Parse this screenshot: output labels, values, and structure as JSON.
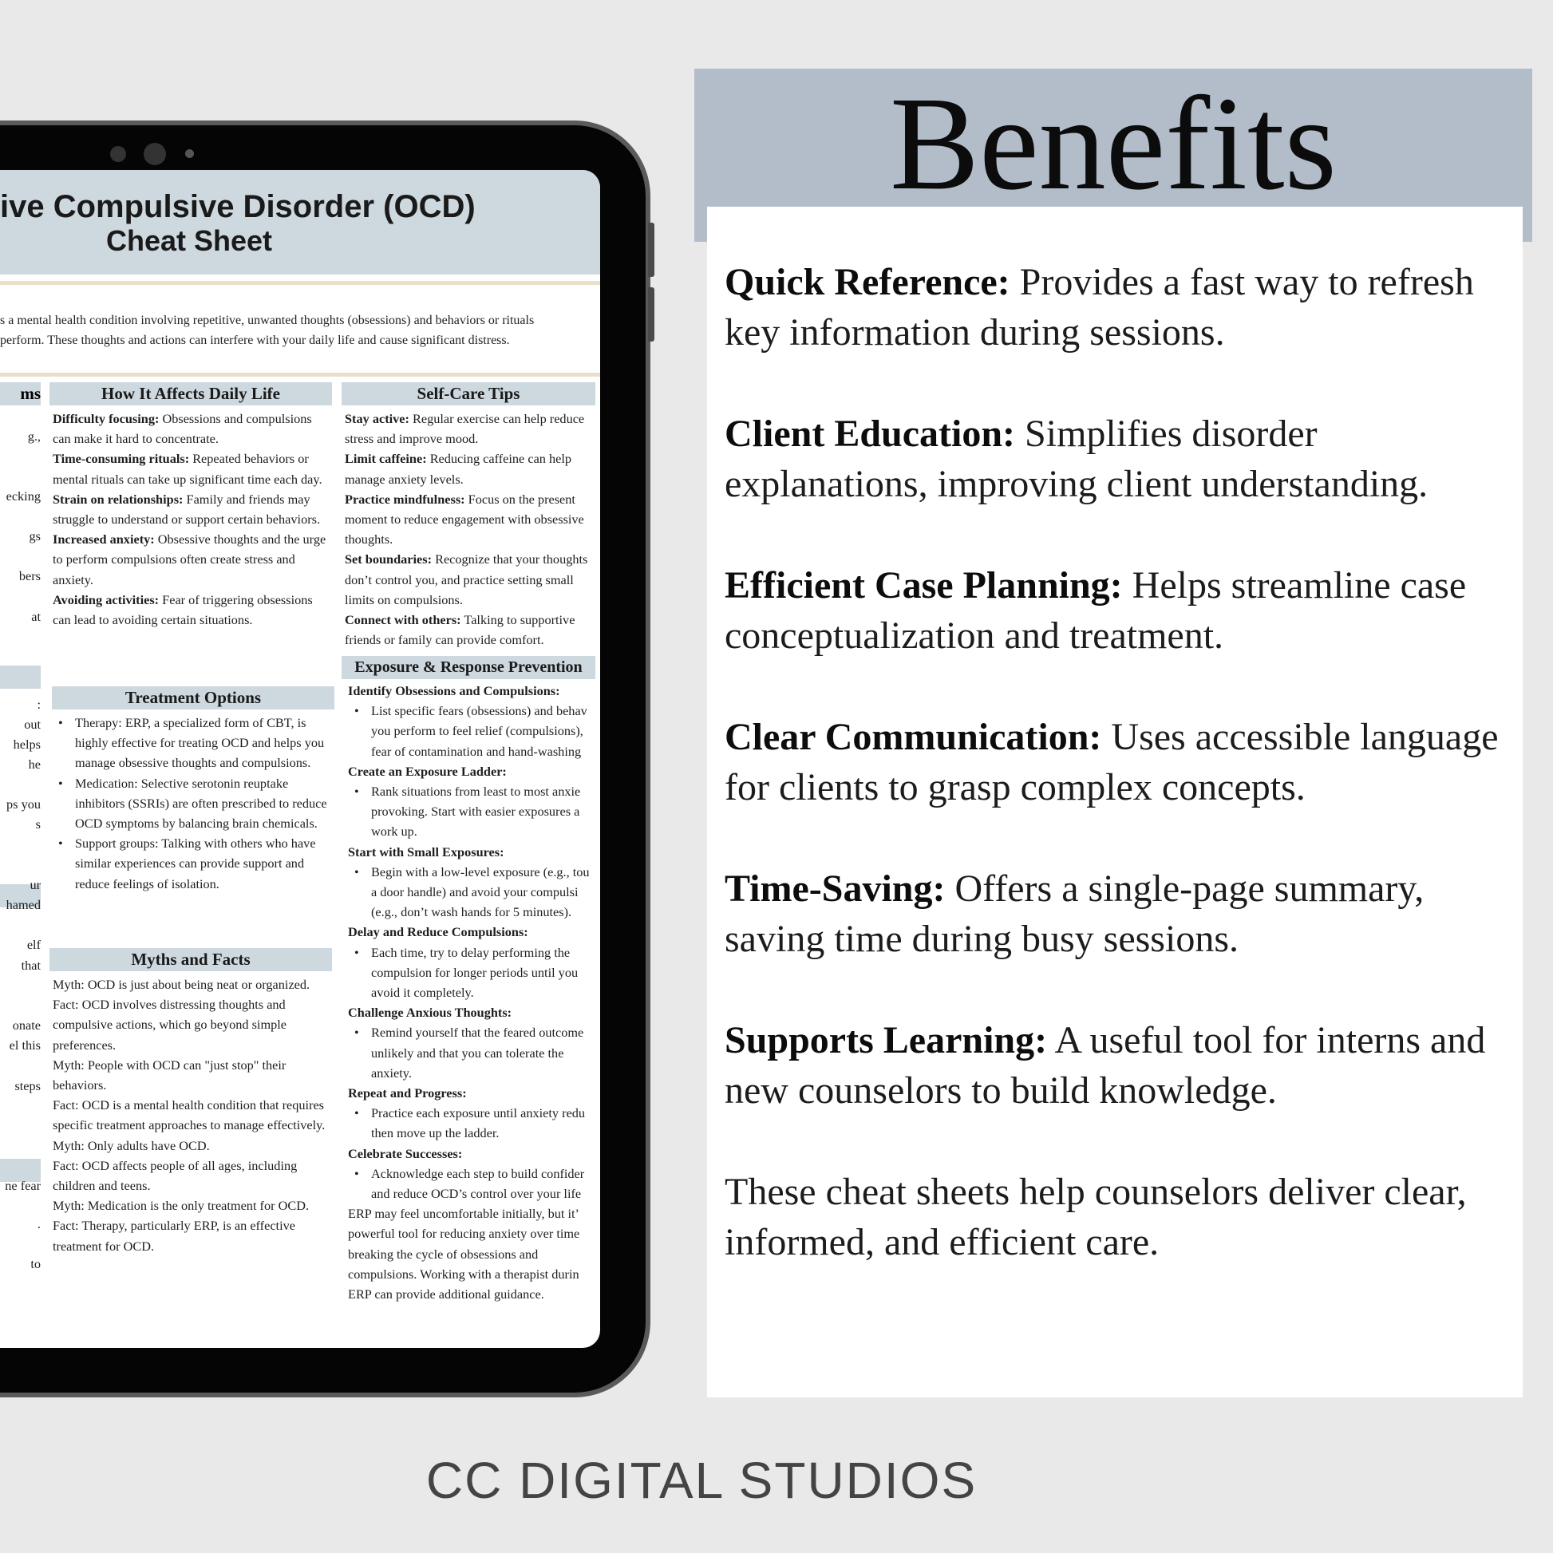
{
  "tablet": {
    "title_line1": "ive Compulsive Disorder (OCD)",
    "title_line2": "Cheat Sheet",
    "intro": [
      "s a mental health condition involving repetitive, unwanted thoughts (obsessions) and behaviors or rituals",
      " perform. These thoughts and actions can interfere with your daily life and cause significant distress."
    ],
    "col1_headers": [
      "ms",
      "",
      "",
      ""
    ],
    "col1_fragments": [
      "g.,",
      "ecking",
      "gs",
      "bers",
      "at",
      ":",
      "out",
      "helps",
      "he",
      "ps you",
      "s",
      "ur",
      "hamed",
      "elf",
      "that",
      "onate",
      "el this",
      "steps",
      "ne fear",
      ".",
      "to"
    ],
    "daily_life": {
      "heading": "How It Affects Daily Life",
      "items": [
        {
          "label": "Difficulty focusing:",
          "text": " Obsessions and compulsions can make it hard to concentrate."
        },
        {
          "label": "Time-consuming rituals:",
          "text": " Repeated behaviors or mental rituals can take up significant time each day."
        },
        {
          "label": "Strain on relationships:",
          "text": " Family and friends may struggle to understand or support certain behaviors."
        },
        {
          "label": "Increased anxiety:",
          "text": " Obsessive thoughts and the urge to perform compulsions often create stress and anxiety."
        },
        {
          "label": "Avoiding activities:",
          "text": " Fear of triggering obsessions can lead to avoiding certain situations."
        }
      ]
    },
    "treatment": {
      "heading": "Treatment Options",
      "items": [
        "Therapy: ERP, a specialized form of CBT, is highly effective for treating OCD and helps you manage obsessive thoughts and compulsions.",
        "Medication: Selective serotonin reuptake inhibitors (SSRIs) are often prescribed to reduce OCD symptoms by balancing brain chemicals.",
        "Support groups: Talking with others who have similar experiences can provide support and reduce feelings of isolation."
      ]
    },
    "myths": {
      "heading": "Myths and Facts",
      "items": [
        "Myth: OCD is just about being neat or organized.",
        "Fact: OCD involves distressing thoughts and compulsive actions, which go beyond simple preferences.",
        "Myth: People with OCD can \"just stop\" their behaviors.",
        "Fact: OCD is a mental health condition that requires specific treatment approaches to manage effectively.",
        "Myth: Only adults have OCD.",
        "Fact: OCD affects people of all ages, including children and teens.",
        "Myth: Medication is the only treatment for OCD.",
        "Fact: Therapy, particularly ERP, is an effective treatment for OCD."
      ]
    },
    "selfcare": {
      "heading": "Self-Care Tips",
      "items": [
        {
          "label": "Stay active:",
          "text": " Regular exercise can help reduce stress and improve mood."
        },
        {
          "label": "Limit caffeine:",
          "text": " Reducing caffeine can help manage anxiety levels."
        },
        {
          "label": "Practice mindfulness:",
          "text": " Focus on the present moment to reduce engagement with obsessive thoughts."
        },
        {
          "label": "Set boundaries:",
          "text": " Recognize that your thoughts don’t control you, and practice setting small limits on compulsions."
        },
        {
          "label": "Connect with others:",
          "text": " Talking to supportive friends or family can provide comfort."
        }
      ]
    },
    "erp": {
      "heading": "Exposure & Response Prevention",
      "steps": [
        {
          "title": "Identify Obsessions and Compulsions:",
          "bullet": "List specific fears (obsessions) and behav you perform to feel relief (compulsions), fear of contamination and hand-washing"
        },
        {
          "title": "Create an Exposure Ladder:",
          "bullet": "Rank situations from least to most anxie provoking. Start with easier exposures a work up."
        },
        {
          "title": "Start with Small Exposures:",
          "bullet": "Begin with a low-level exposure (e.g., tou a door handle) and avoid your compulsi (e.g., don’t wash hands for 5 minutes)."
        },
        {
          "title": "Delay and Reduce Compulsions:",
          "bullet": "Each time, try to delay performing the compulsion for longer periods until you avoid it completely."
        },
        {
          "title": "Challenge Anxious Thoughts:",
          "bullet": "Remind yourself that the feared outcome unlikely and that you can tolerate the anxiety."
        },
        {
          "title": "Repeat and Progress:",
          "bullet": "Practice each exposure until anxiety redu then move up the ladder."
        },
        {
          "title": "Celebrate Successes:",
          "bullet": "Acknowledge each step to build confider and reduce OCD’s control over your life"
        }
      ],
      "closing": "ERP may feel uncomfortable initially, but it’ powerful tool for reducing anxiety over time breaking the cycle of obsessions and compulsions. Working with a therapist durin ERP can provide additional guidance."
    }
  },
  "benefits": {
    "title": "Benefits",
    "items": [
      {
        "label": "Quick Reference:",
        "text": " Provides a fast way to refresh key information during sessions."
      },
      {
        "label": "Client Education:",
        "text": " Simplifies disorder explanations, improving client understanding."
      },
      {
        "label": "Efficient Case Planning:",
        "text": " Helps streamline case conceptualization and treatment."
      },
      {
        "label": "Clear Communication:",
        "text": " Uses accessible language for clients to grasp complex concepts."
      },
      {
        "label": "Time-Saving:",
        "text": " Offers a single-page summary, saving time during busy sessions."
      },
      {
        "label": "Supports Learning:",
        "text": " A useful tool for interns and new counselors to build knowledge."
      }
    ],
    "closing": "These cheat sheets help counselors deliver clear, informed, and efficient care."
  },
  "footer": "CC DIGITAL STUDIOS",
  "colors": {
    "background": "#e9e9e9",
    "header_band": "#b3bdc9",
    "section_band": "#cdd8df",
    "accent_rule": "#eadfc9"
  }
}
